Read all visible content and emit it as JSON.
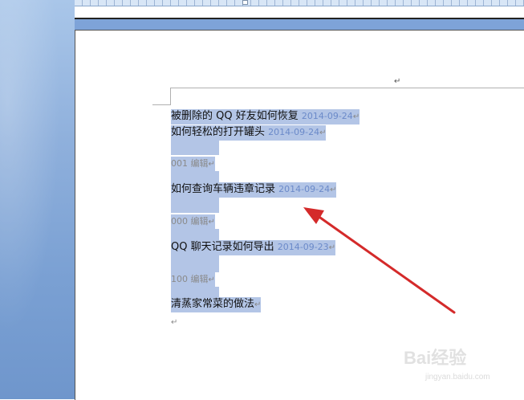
{
  "document": {
    "header_return": "↵",
    "lines": [
      {
        "title": "被删除的 QQ 好友如何恢复",
        "date": "2014-09-24",
        "mark": "↵"
      },
      {
        "title": "如何轻松的打开罐头",
        "date": "2014-09-24",
        "mark": "↵"
      },
      {
        "meta": "001 编辑",
        "mark": "↵"
      },
      {
        "title": "如何查询车辆违章记录",
        "date": "2014-09-24",
        "mark": "↵"
      },
      {
        "meta": "000 编辑",
        "mark": "↵"
      },
      {
        "title": "QQ 聊天记录如何导出",
        "date": "2014-09-23",
        "mark": "↵"
      },
      {
        "meta": "100 编辑",
        "mark": "↵"
      },
      {
        "title": "清蒸家常菜的做法",
        "mark": "↵"
      },
      {
        "mark": "↵"
      }
    ]
  },
  "watermark": {
    "brand": "Bai经验",
    "url": "jingyan.baidu.com"
  },
  "colors": {
    "selection": "#b3c5e6",
    "arrow": "#d42a2a",
    "date": "#6b8ac9"
  }
}
